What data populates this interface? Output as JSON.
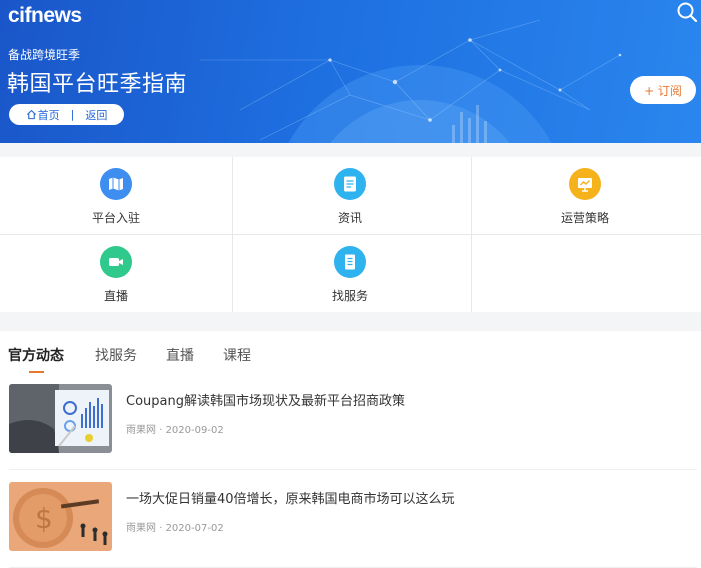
{
  "header": {
    "logo_text": "cifnews",
    "subtitle": "备战跨境旺季",
    "title": "韩国平台旺季指南",
    "breadcrumb": {
      "home_label": "首页",
      "separator": "|",
      "back_label": "返回"
    },
    "subscribe_label": "+ 订阅"
  },
  "nav_grid": [
    {
      "label": "平台入驻",
      "icon": "map-icon",
      "color": "#3d8ef0"
    },
    {
      "label": "资讯",
      "icon": "document-icon",
      "color": "#2fb3ef"
    },
    {
      "label": "运营策略",
      "icon": "chart-board-icon",
      "color": "#f5b21a"
    },
    {
      "label": "直播",
      "icon": "video-camera-icon",
      "color": "#2fc98c"
    },
    {
      "label": "找服务",
      "icon": "service-list-icon",
      "color": "#2fb3ef"
    }
  ],
  "feed": {
    "tabs": [
      {
        "label": "官方动态",
        "active": true
      },
      {
        "label": "找服务",
        "active": false
      },
      {
        "label": "直播",
        "active": false
      },
      {
        "label": "课程",
        "active": false
      }
    ],
    "accent_color": "#e8772e",
    "articles": [
      {
        "title": "Coupang解读韩国市场现状及最新平台招商政策",
        "source": "雨果网",
        "dot": "·",
        "date": "2020-09-02"
      },
      {
        "title": "一场大促日销量40倍增长，原来韩国电商市场可以这么玩",
        "source": "雨果网",
        "dot": "·",
        "date": "2020-07-02"
      }
    ]
  }
}
